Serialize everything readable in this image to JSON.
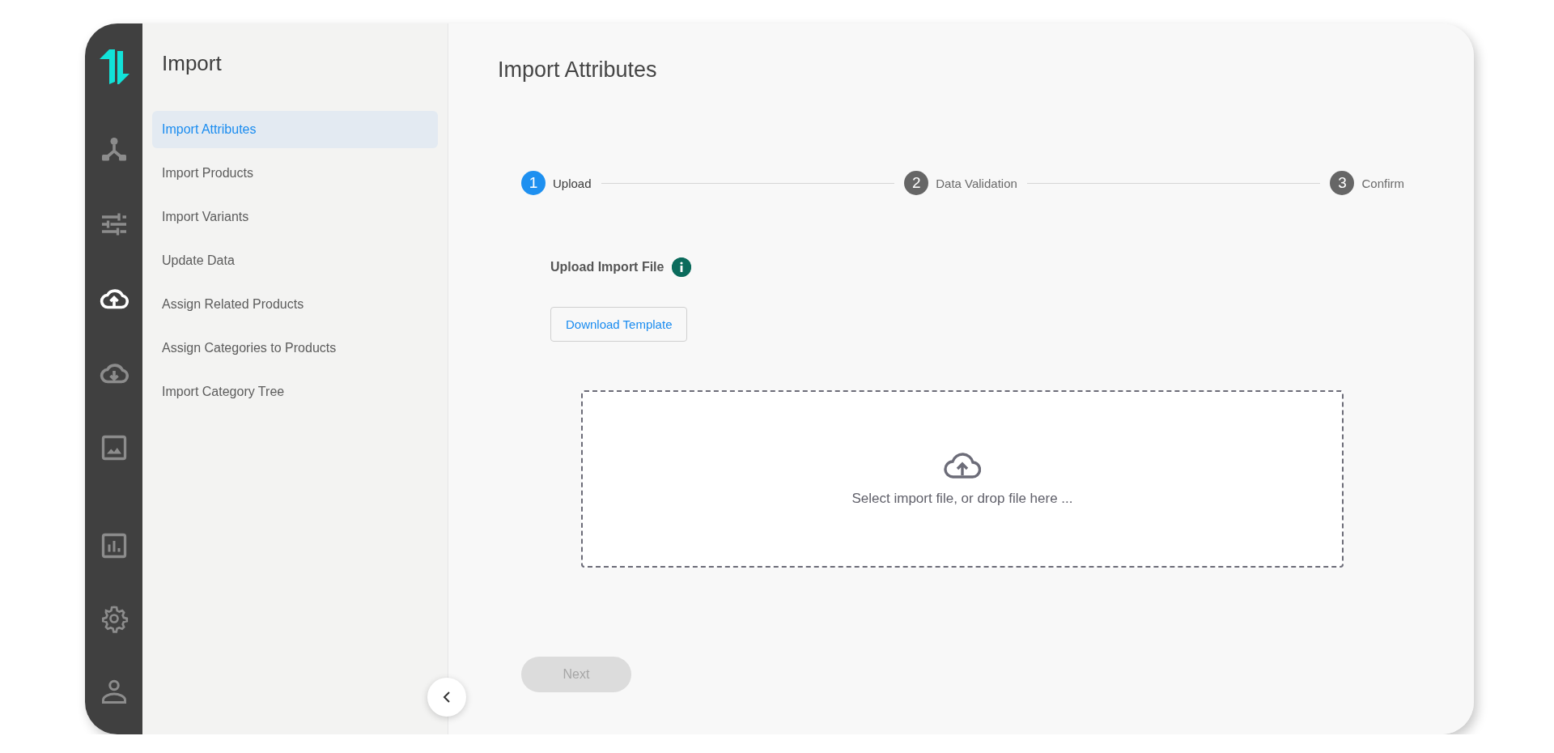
{
  "rail": {
    "items": [
      {
        "selected": false
      },
      {
        "selected": false
      },
      {
        "selected": true
      },
      {
        "selected": false
      },
      {
        "selected": false
      },
      {
        "selected": false
      },
      {
        "selected": false
      },
      {
        "selected": false
      }
    ]
  },
  "menu": {
    "title": "Import",
    "items": [
      {
        "label": "Import Attributes",
        "selected": true
      },
      {
        "label": "Import Products",
        "selected": false
      },
      {
        "label": "Import Variants",
        "selected": false
      },
      {
        "label": "Update Data",
        "selected": false
      },
      {
        "label": "Assign Related Products",
        "selected": false
      },
      {
        "label": "Assign Categories to Products",
        "selected": false
      },
      {
        "label": "Import Category Tree",
        "selected": false
      }
    ]
  },
  "main": {
    "title": "Import Attributes",
    "steps": [
      {
        "number": "1",
        "label": "Upload",
        "active": true
      },
      {
        "number": "2",
        "label": "Data Validation",
        "active": false
      },
      {
        "number": "3",
        "label": "Confirm",
        "active": false
      }
    ],
    "upload_label": "Upload Import File",
    "download_button": "Download Template",
    "dropzone_text": "Select import file, or drop file here ...",
    "next_button": {
      "label": "Next",
      "disabled": true
    }
  }
}
